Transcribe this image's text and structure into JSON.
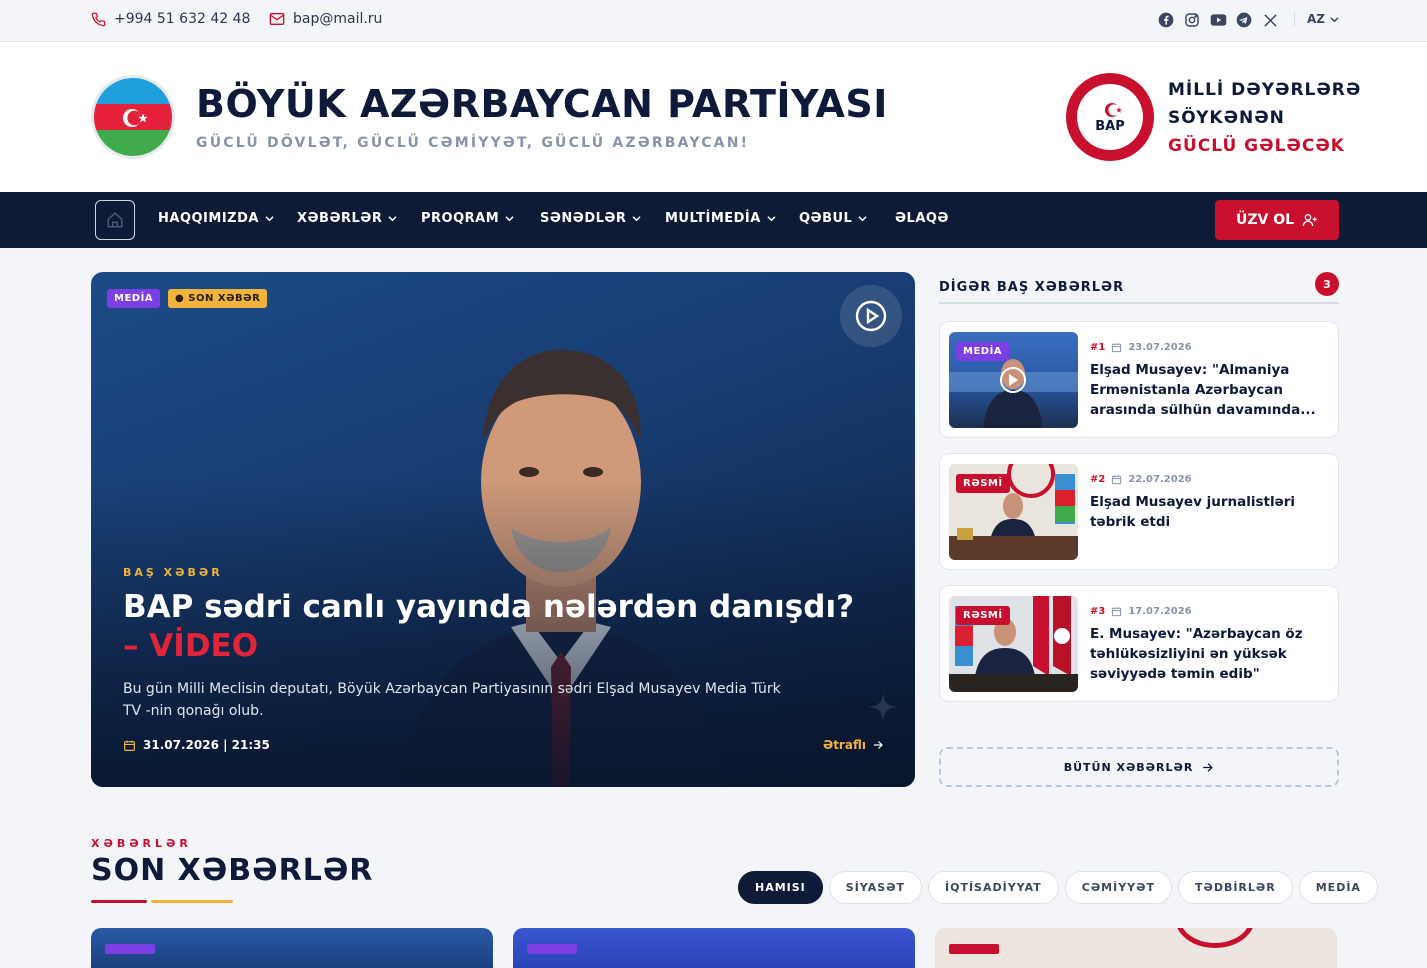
{
  "topbar": {
    "phone": "+994 51 632 42 48",
    "email": "bap@mail.ru",
    "social_icons": [
      "facebook-icon",
      "instagram-icon",
      "youtube-icon",
      "telegram-icon",
      "x-icon"
    ],
    "language": "AZ"
  },
  "header": {
    "title": "BÖYÜK AZƏRBAYCAN PARTİYASI",
    "slogan": "GÜCLÜ DÖVLƏT, GÜCLÜ CƏMİYYƏT, GÜCLÜ AZƏRBAYCAN!",
    "motto_line1": "MİLLİ DƏYƏRLƏRƏ",
    "motto_line2": "SÖYKƏNƏN",
    "motto_line3": "GÜCLÜ GƏLƏCƏK",
    "logo_text": "BAP"
  },
  "nav": {
    "items": [
      {
        "label": "HAQQIMIZDA"
      },
      {
        "label": "XƏBƏRLƏR"
      },
      {
        "label": "PROQRAM"
      },
      {
        "label": "SƏNƏDLƏR"
      },
      {
        "label": "MULTİMEDİA"
      },
      {
        "label": "QƏBUL"
      },
      {
        "label": "ƏLAQƏ"
      }
    ],
    "join_label": "ÜZV OL"
  },
  "hero": {
    "tag_media": "MEDİA",
    "tag_latest": "SON XƏBƏR",
    "kicker": "BAŞ XƏBƏR",
    "title": "BAP sədri canlı yayında nələrdən danışdı?",
    "title_accent": "– VİDEO",
    "description": "Bu gün Milli Meclisin deputatı, Böyük Azərbaycan Partiyasının sədri Elşad Musayev Media Türk TV -nin qonağı olub.",
    "date": "31.07.2026 | 21:35",
    "more": "Ətraflı"
  },
  "sidebar": {
    "title": "DİGƏR BAŞ XƏBƏRLƏR",
    "count": "3",
    "items": [
      {
        "badge": "MEDİA",
        "num": "#1",
        "date": "23.07.2026",
        "title": "Elşad Musayev: \"Almaniya Ermənistanla Azərbaycan arasında sülhün davamında..."
      },
      {
        "badge": "RƏSMİ",
        "num": "#2",
        "date": "22.07.2026",
        "title": "Elşad Musayev jurnalistləri təbrik etdi"
      },
      {
        "badge": "RƏSMİ",
        "num": "#3",
        "date": "17.07.2026",
        "title": "E. Musayev: \"Azərbaycan öz təhlükəsizliyini ən yüksək səviyyədə təmin edib\""
      }
    ],
    "all_news": "BÜTÜN XƏBƏRLƏR"
  },
  "latest": {
    "kicker": "XƏBƏRLƏR",
    "title": "SON XƏBƏRLƏR",
    "filters": [
      "HAMISI",
      "SİYASƏT",
      "İQTİSADİYYAT",
      "CƏMİYYƏT",
      "TƏDBİRLƏR",
      "MEDİA"
    ]
  },
  "colors": {
    "brand_red": "#c8102e",
    "navy": "#0d1b37",
    "gold": "#f0b43c",
    "media_purple": "#7b3fe4"
  }
}
